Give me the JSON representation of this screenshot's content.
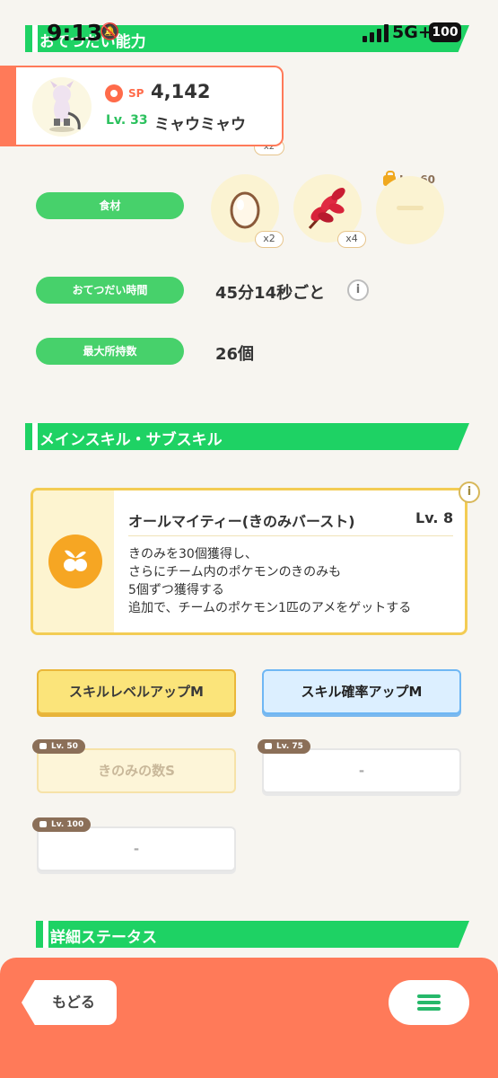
{
  "status_bar": {
    "time": "9:13",
    "network": "5G+",
    "battery": "100"
  },
  "pokemon": {
    "sp_label": "SP",
    "sp_value": "4,142",
    "level": "Lv. 33",
    "name": "ミャウミャウ"
  },
  "help_section": {
    "title": "おてつだい能力",
    "peek_count": "x2",
    "ingredients_label": "食材",
    "ingredients": [
      {
        "icon": "egg-icon",
        "count": "x2"
      },
      {
        "icon": "herb-icon",
        "count": "x4"
      },
      {
        "icon": "locked-slot",
        "unlock_level": "Lv. 60"
      }
    ],
    "help_time_label": "おてつだい時間",
    "help_time_value": "45分14秒ごと",
    "max_carry_label": "最大所持数",
    "max_carry_value": "26個"
  },
  "skills_section": {
    "title": "メインスキル・サブスキル",
    "main_skill": {
      "name": "オールマイティー(きのみバースト)",
      "level": "Lv. 8",
      "description": [
        "きのみを30個獲得し、",
        "さらにチーム内のポケモンのきのみも",
        "5個ずつ獲得する",
        "追加で、チームのポケモン1匹のアメをゲットする"
      ]
    },
    "sub_skills": [
      {
        "label": "スキルレベルアップM",
        "style": "gold"
      },
      {
        "label": "スキル確率アップM",
        "style": "blue"
      },
      {
        "label": "きのみの数S",
        "unlock_level": "Lv. 50",
        "locked": true
      },
      {
        "label": "-",
        "unlock_level": "Lv. 75",
        "locked": true
      },
      {
        "label": "-",
        "unlock_level": "Lv. 100",
        "locked": true
      }
    ]
  },
  "details_section": {
    "title": "詳細ステータス"
  },
  "nav": {
    "back_label": "もどる"
  },
  "colors": {
    "accent_green": "#1ed264",
    "accent_orange": "#ff7a59",
    "skill_gold": "#f3cc54"
  }
}
